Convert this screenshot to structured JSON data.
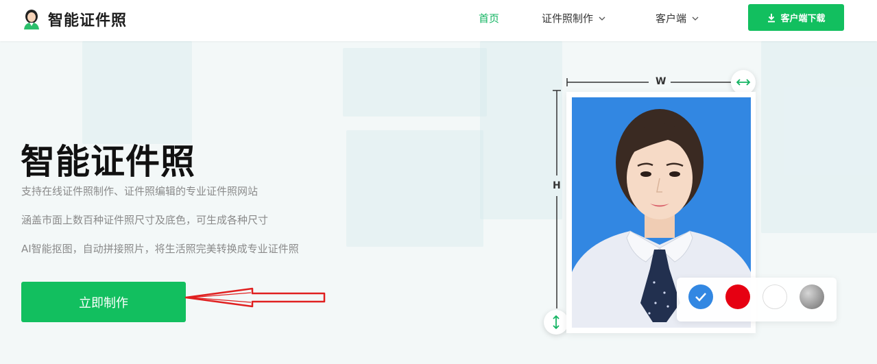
{
  "header": {
    "logo_text": "智能证件照",
    "nav": [
      {
        "label": "首页",
        "active": true
      },
      {
        "label": "证件照制作",
        "has_dropdown": true
      },
      {
        "label": "客户端",
        "has_dropdown": true
      }
    ],
    "download_label": "客户端下载"
  },
  "hero": {
    "title": "智能证件照",
    "lines": [
      "支持在线证件照制作、证件照编辑的专业证件照网站",
      "涵盖市面上数百种证件照尺寸及底色，可生成各种尺寸",
      "AI智能抠图，自动拼接照片，将生活照完美转换成专业证件照"
    ],
    "cta_label": "立即制作"
  },
  "illustration": {
    "width_label": "W",
    "height_label": "H",
    "background_colors": [
      {
        "name": "blue",
        "hex": "#3287e2",
        "selected": true
      },
      {
        "name": "red",
        "hex": "#e60012",
        "selected": false
      },
      {
        "name": "white",
        "hex": "#ffffff",
        "selected": false
      },
      {
        "name": "gray",
        "hex": "#8c8c8c",
        "selected": false
      }
    ]
  },
  "colors": {
    "brand_green": "#12bf5f",
    "active_nav": "#13b462",
    "arrow_red": "#e02020"
  }
}
